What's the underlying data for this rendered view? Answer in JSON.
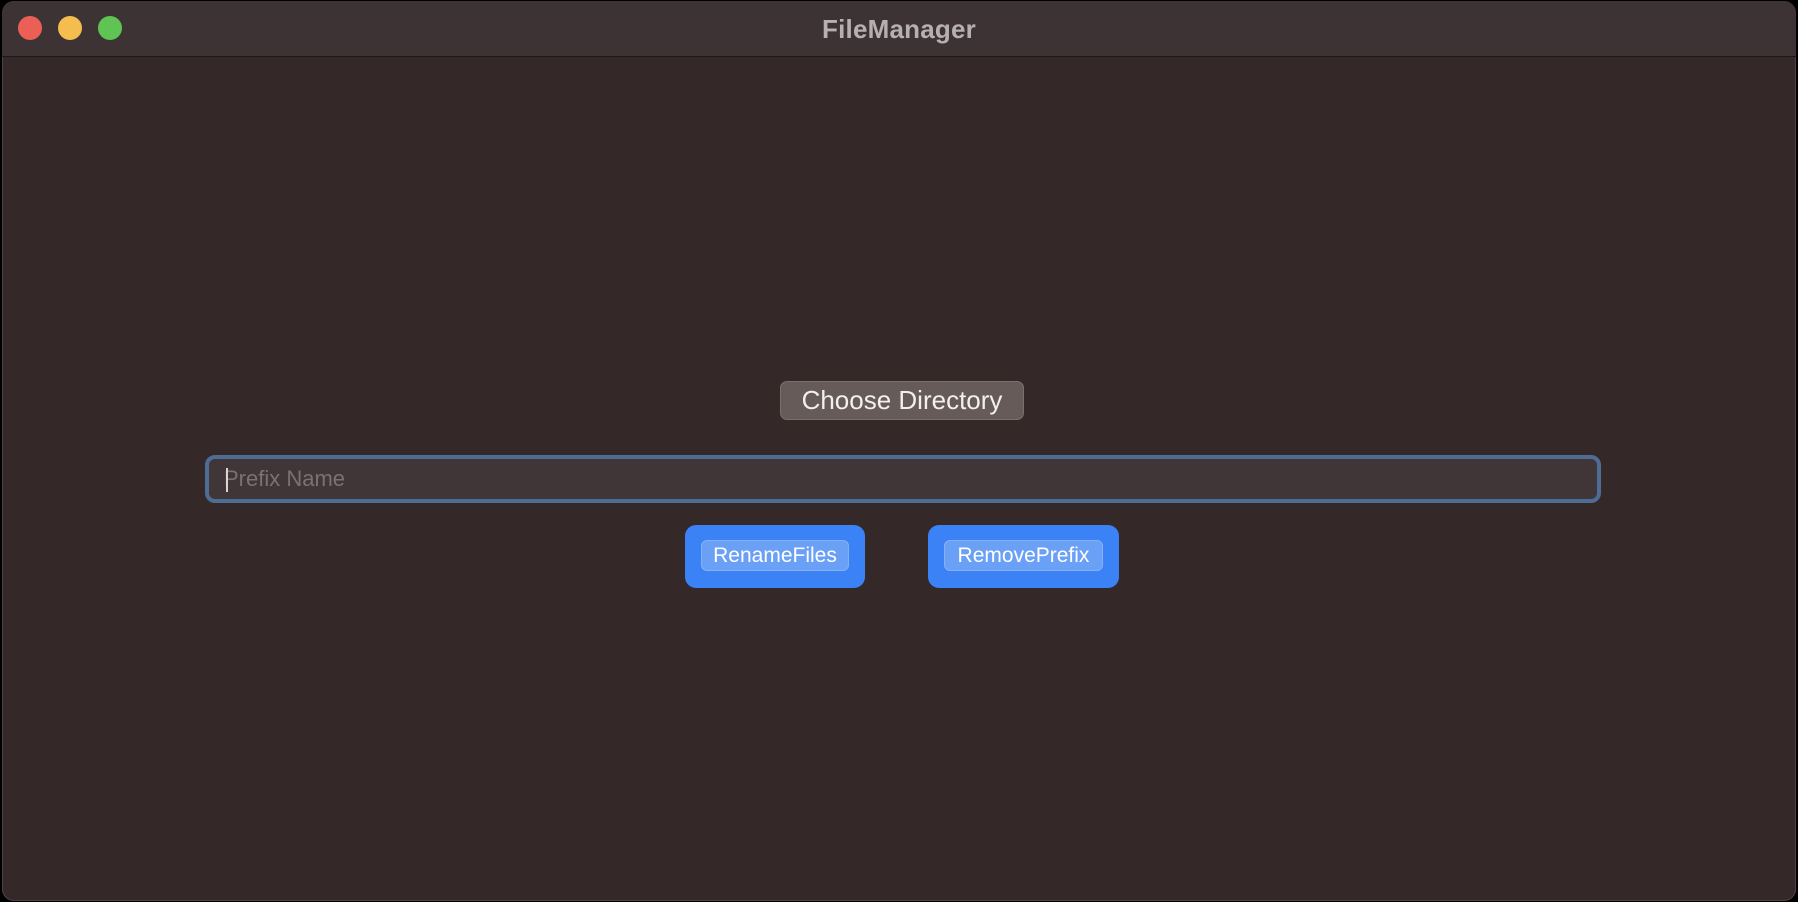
{
  "window": {
    "title": "FileManager",
    "controls": {
      "close_color": "#ec5f57",
      "minimize_color": "#f4bd4f",
      "zoom_color": "#5fc453"
    }
  },
  "main": {
    "choose_directory_label": "Choose Directory",
    "prefix_input": {
      "value": "",
      "placeholder": "Prefix Name"
    },
    "rename_files_label": "RenameFiles",
    "remove_prefix_label": "RemovePrefix"
  },
  "colors": {
    "background": "#342829",
    "accent": "#3a82f6",
    "focus_ring": "#4e6d95"
  }
}
